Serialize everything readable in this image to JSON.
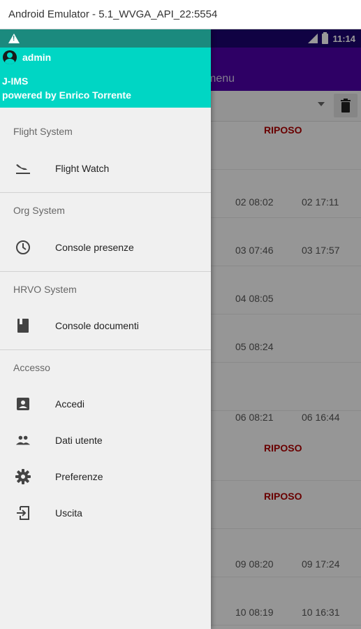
{
  "window": {
    "title": "Android Emulator - 5.1_WVGA_API_22:5554"
  },
  "status_bar": {
    "time": "11:14"
  },
  "background": {
    "menu_title": "menu",
    "rows": [
      {
        "kind": "riposo",
        "label": "RIPOSO"
      },
      {
        "kind": "times",
        "t1": "02 08:02",
        "t2": "02 17:11"
      },
      {
        "kind": "times",
        "t1": "03 07:46",
        "t2": "03 17:57"
      },
      {
        "kind": "times",
        "t1": "04 08:05",
        "t2": ""
      },
      {
        "kind": "times",
        "t1": "05 08:24",
        "t2": ""
      },
      {
        "kind": "times",
        "t1": "06 08:21",
        "t2": "06 16:44"
      },
      {
        "kind": "riposo",
        "label": "RIPOSO"
      },
      {
        "kind": "riposo",
        "label": "RIPOSO"
      },
      {
        "kind": "times",
        "t1": "09 08:20",
        "t2": "09 17:24"
      },
      {
        "kind": "times",
        "t1": "10 08:19",
        "t2": "10 16:31"
      }
    ]
  },
  "drawer": {
    "header": {
      "username": "admin",
      "app_name": "J-IMS",
      "powered_by": "powered by Enrico Torrente"
    },
    "sections": [
      {
        "title": "Flight System",
        "items": [
          {
            "label": "Flight Watch",
            "icon": "flight-land-icon"
          }
        ]
      },
      {
        "title": "Org System",
        "items": [
          {
            "label": "Console presenze",
            "icon": "clock-icon"
          }
        ]
      },
      {
        "title": "HRVO System",
        "items": [
          {
            "label": "Console documenti",
            "icon": "book-icon"
          }
        ]
      },
      {
        "title": "Accesso",
        "items": [
          {
            "label": "Accedi",
            "icon": "account-box-icon"
          },
          {
            "label": "Dati utente",
            "icon": "people-icon"
          },
          {
            "label": "Preferenze",
            "icon": "gear-icon"
          },
          {
            "label": "Uscita",
            "icon": "exit-icon"
          }
        ]
      }
    ]
  },
  "colors": {
    "status_bar": "#1c0470",
    "app_bar": "#4e00a8",
    "drawer_header": "#00d6c4",
    "riposo": "#b00000"
  }
}
